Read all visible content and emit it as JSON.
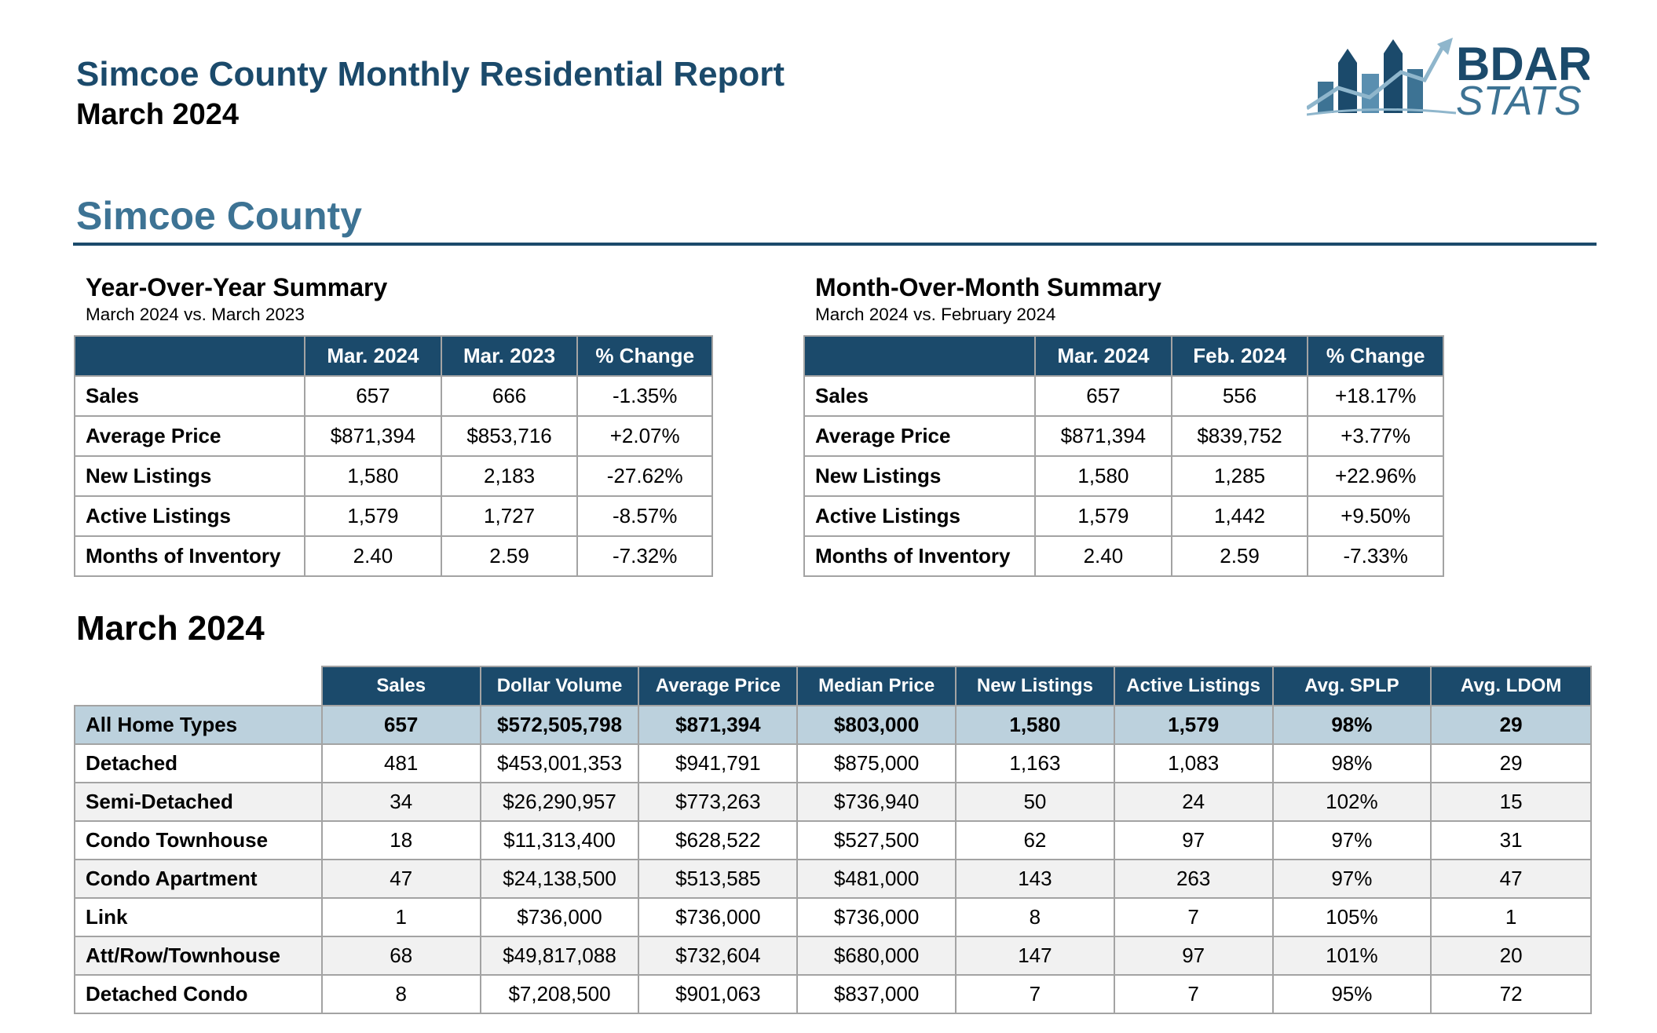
{
  "header": {
    "title": "Simcoe County Monthly Residential Report",
    "subtitle": "March 2024",
    "logo_line1": "BDAR",
    "logo_line2": "STATS"
  },
  "section_title": "Simcoe County",
  "yoy": {
    "title": "Year-Over-Year Summary",
    "subtitle": "March 2024 vs. March 2023",
    "columns": [
      "Mar. 2024",
      "Mar. 2023",
      "% Change"
    ],
    "rows": [
      {
        "label": "Sales",
        "values": [
          "657",
          "666",
          "-1.35%"
        ]
      },
      {
        "label": "Average Price",
        "values": [
          "$871,394",
          "$853,716",
          "+2.07%"
        ]
      },
      {
        "label": "New Listings",
        "values": [
          "1,580",
          "2,183",
          "-27.62%"
        ]
      },
      {
        "label": "Active Listings",
        "values": [
          "1,579",
          "1,727",
          "-8.57%"
        ]
      },
      {
        "label": "Months of Inventory",
        "values": [
          "2.40",
          "2.59",
          "-7.32%"
        ]
      }
    ]
  },
  "mom": {
    "title": "Month-Over-Month Summary",
    "subtitle": "March 2024 vs. February 2024",
    "columns": [
      "Mar. 2024",
      "Feb. 2024",
      "% Change"
    ],
    "rows": [
      {
        "label": "Sales",
        "values": [
          "657",
          "556",
          "+18.17%"
        ]
      },
      {
        "label": "Average Price",
        "values": [
          "$871,394",
          "$839,752",
          "+3.77%"
        ]
      },
      {
        "label": "New Listings",
        "values": [
          "1,580",
          "1,285",
          "+22.96%"
        ]
      },
      {
        "label": "Active Listings",
        "values": [
          "1,579",
          "1,442",
          "+9.50%"
        ]
      },
      {
        "label": "Months of Inventory",
        "values": [
          "2.40",
          "2.59",
          "-7.33%"
        ]
      }
    ]
  },
  "detail": {
    "title": "March 2024",
    "columns": [
      "Sales",
      "Dollar Volume",
      "Average Price",
      "Median Price",
      "New Listings",
      "Active Listings",
      "Avg. SPLP",
      "Avg. LDOM"
    ],
    "rows": [
      {
        "label": "All Home Types",
        "values": [
          "657",
          "$572,505,798",
          "$871,394",
          "$803,000",
          "1,580",
          "1,579",
          "98%",
          "29"
        ]
      },
      {
        "label": "Detached",
        "values": [
          "481",
          "$453,001,353",
          "$941,791",
          "$875,000",
          "1,163",
          "1,083",
          "98%",
          "29"
        ]
      },
      {
        "label": "Semi-Detached",
        "values": [
          "34",
          "$26,290,957",
          "$773,263",
          "$736,940",
          "50",
          "24",
          "102%",
          "15"
        ]
      },
      {
        "label": "Condo Townhouse",
        "values": [
          "18",
          "$11,313,400",
          "$628,522",
          "$527,500",
          "62",
          "97",
          "97%",
          "31"
        ]
      },
      {
        "label": "Condo Apartment",
        "values": [
          "47",
          "$24,138,500",
          "$513,585",
          "$481,000",
          "143",
          "263",
          "97%",
          "47"
        ]
      },
      {
        "label": "Link",
        "values": [
          "1",
          "$736,000",
          "$736,000",
          "$736,000",
          "8",
          "7",
          "105%",
          "1"
        ]
      },
      {
        "label": "Att/Row/Townhouse",
        "values": [
          "68",
          "$49,817,088",
          "$732,604",
          "$680,000",
          "147",
          "97",
          "101%",
          "20"
        ]
      },
      {
        "label": "Detached Condo",
        "values": [
          "8",
          "$7,208,500",
          "$901,063",
          "$837,000",
          "7",
          "7",
          "95%",
          "72"
        ]
      }
    ]
  },
  "colors": {
    "header_navy": "#1b4a6b",
    "section_blue": "#3d7394",
    "total_row": "#bcd1dd",
    "alt_row": "#f1f1f1"
  }
}
